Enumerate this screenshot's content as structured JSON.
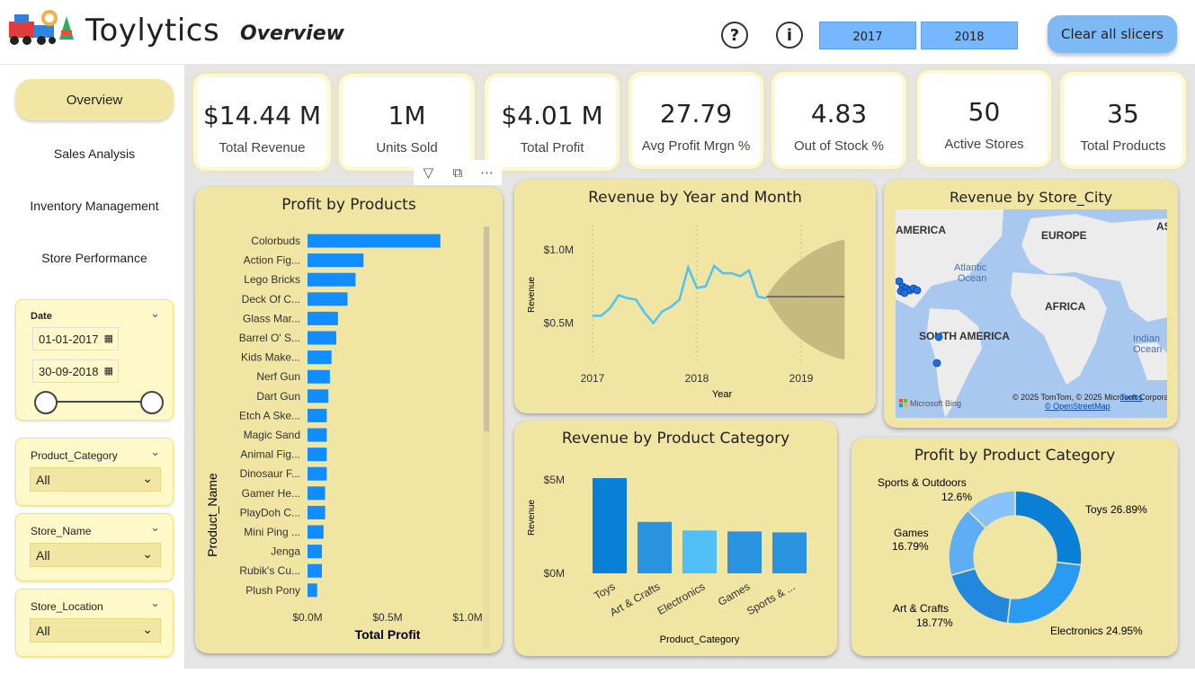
{
  "app": {
    "title": "Toylytics",
    "page_heading": "Overview"
  },
  "header": {
    "help_icon": "?",
    "info_icon": "i",
    "years": [
      "2017",
      "2018"
    ],
    "clear_label": "Clear all slicers"
  },
  "nav": [
    {
      "label": "Overview",
      "active": true
    },
    {
      "label": "Sales Analysis"
    },
    {
      "label": "Inventory Management"
    },
    {
      "label": "Store Performance"
    }
  ],
  "slicers": {
    "date": {
      "title": "Date",
      "start": "01-01-2017",
      "end": "30-09-2018"
    },
    "category": {
      "title": "Product_Category",
      "value": "All"
    },
    "store_name": {
      "title": "Store_Name",
      "value": "All"
    },
    "store_location": {
      "title": "Store_Location",
      "value": "All"
    }
  },
  "kpis": [
    {
      "value": "$14.44 M",
      "label": "Total Revenue"
    },
    {
      "value": "1M",
      "label": "Units Sold"
    },
    {
      "value": "$4.01 M",
      "label": "Total Profit"
    },
    {
      "value": "27.79",
      "label": "Avg Profit Mrgn %"
    },
    {
      "value": "4.83",
      "label": "Out of Stock %"
    },
    {
      "value": "50",
      "label": "Active Stores"
    },
    {
      "value": "35",
      "label": "Total Products"
    }
  ],
  "colors": {
    "card": "#f0e5a3",
    "bar": "#118dff",
    "line": "#4fc3f7"
  },
  "map": {
    "title": "Revenue by Store_City",
    "labels": {
      "america": "AMERICA",
      "europe": "EUROPE",
      "as": "AS",
      "atlantic": "Atlantic",
      "ocean": "Ocean",
      "africa": "AFRICA",
      "south_america": "SOUTH AMERICA",
      "indian": "Indian",
      "indian_ocean": "Ocean"
    },
    "credit": "© 2025 TomTom, © 2025 Microsoft Corporation,",
    "terms": "Terms",
    "osm": "© OpenStreetMap",
    "bing": "Microsoft Bing"
  },
  "chart_data": [
    {
      "type": "bar",
      "orientation": "horizontal",
      "title": "Profit by Products",
      "xlabel": "Total Profit",
      "ylabel": "Product_Name",
      "xlim": [
        0,
        1.0
      ],
      "xticks": [
        "$0.0M",
        "$0.5M",
        "$1.0M"
      ],
      "categories": [
        "Colorbuds",
        "Action Fig...",
        "Lego Bricks",
        "Deck Of C...",
        "Glass Mar...",
        "Barrel O' S...",
        "Kids Make...",
        "Nerf Gun",
        "Dart Gun",
        "Etch A Ske...",
        "Magic Sand",
        "Animal Fig...",
        "Dinosaur F...",
        "Gamer He...",
        "PlayDoh C...",
        "Mini Ping ...",
        "Jenga",
        "Rubik's Cu...",
        "Plush Pony"
      ],
      "values": [
        0.83,
        0.35,
        0.3,
        0.25,
        0.19,
        0.18,
        0.15,
        0.14,
        0.13,
        0.12,
        0.12,
        0.12,
        0.12,
        0.11,
        0.11,
        0.1,
        0.09,
        0.09,
        0.06
      ]
    },
    {
      "type": "line",
      "title": "Revenue by Year and Month",
      "xlabel": "Year",
      "ylabel": "Revenue",
      "xticks": [
        "2017",
        "2018",
        "2019"
      ],
      "yticks": [
        "$0.5M",
        "$1.0M"
      ],
      "x": [
        "2017-01",
        "2017-02",
        "2017-03",
        "2017-04",
        "2017-05",
        "2017-06",
        "2017-07",
        "2017-08",
        "2017-09",
        "2017-10",
        "2017-11",
        "2017-12",
        "2018-01",
        "2018-02",
        "2018-03",
        "2018-04",
        "2018-05",
        "2018-06",
        "2018-07",
        "2018-08",
        "2018-09"
      ],
      "values": [
        0.55,
        0.55,
        0.6,
        0.69,
        0.67,
        0.66,
        0.57,
        0.5,
        0.58,
        0.61,
        0.66,
        0.88,
        0.74,
        0.75,
        0.89,
        0.84,
        0.84,
        0.82,
        0.86,
        0.68,
        0.67
      ],
      "forecast": {
        "x": [
          "2018-10",
          "2019-06"
        ],
        "value": 0.68,
        "upper_end": 1.07,
        "lower_end": 0.25
      }
    },
    {
      "type": "bar",
      "title": "Revenue by Product Category",
      "xlabel": "Product_Category",
      "ylabel": "Revenue",
      "yticks": [
        "$0M",
        "$5M"
      ],
      "categories": [
        "Toys",
        "Art & Crafts",
        "Electronics",
        "Games",
        "Sports & ..."
      ],
      "values": [
        5.0,
        2.7,
        2.25,
        2.2,
        2.15
      ]
    },
    {
      "type": "pie",
      "donut": true,
      "title": "Profit by Product Category",
      "categories": [
        "Toys",
        "Electronics",
        "Art & Crafts",
        "Games",
        "Sports & Outdoors"
      ],
      "values": [
        26.89,
        24.95,
        18.77,
        16.79,
        12.6
      ],
      "labels": [
        "Toys 26.89%",
        "Electronics 24.95%",
        "Art & Crafts",
        "18.77%",
        "Games",
        "16.79%",
        "Sports & Outdoors",
        "12.6%"
      ]
    }
  ]
}
